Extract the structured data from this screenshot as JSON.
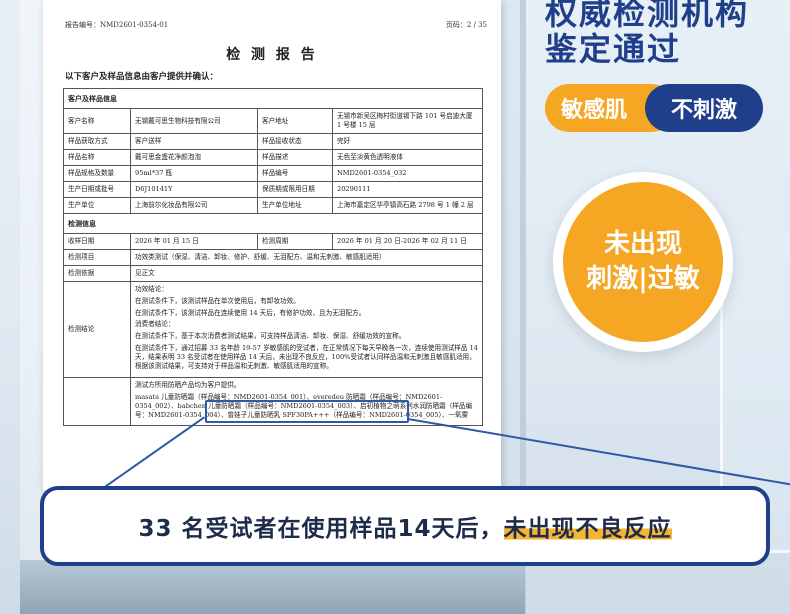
{
  "doc": {
    "report_no": "报告编号：NMD2601-0354-01",
    "page": "页码：2 / 35",
    "title": "检 测 报 告",
    "subtitle": "以下客户及样品信息由客户提供并确认：",
    "sec_customer": "客户及样品信息",
    "customer_name_label": "客户名称",
    "customer_name": "无锡戴可思生物科技有限公司",
    "customer_addr_label": "客户地址",
    "customer_addr": "无锡市新吴区梅村街道锡下路 101 号启迪大厦 1 号楼 15 层",
    "sample_way_label": "样品获取方式",
    "sample_way": "客户送样",
    "sample_state_label": "样品接收状态",
    "sample_state": "完好",
    "sample_name_label": "样品名称",
    "sample_name": "戴可思金盏花净颜泡泡",
    "sample_desc_label": "样品描述",
    "sample_desc": "无色至淡黄色透明液体",
    "spec_label": "样品规格及数量",
    "spec": "95ml*37 瓶",
    "sample_no_label": "样品编号",
    "sample_no": "NMD2601-0354_032",
    "batch_label": "生产日期或批号",
    "batch": "D6J10141Y",
    "expiry_label": "保质期或限用日期",
    "expiry": "20290111",
    "maker_label": "生产单位",
    "maker": "上海前尔化妆品有限公司",
    "maker_addr_label": "生产单位地址",
    "maker_addr": "上海市嘉定区华亭镇高石路 2798 号 1 幢 2 层",
    "sec_test": "检测信息",
    "recv_date_label": "收样日期",
    "recv_date": "2026 年 01 月 15 日",
    "test_period_label": "检测周期",
    "test_period": "2026 年 01 月 20 日-2026 年 02 月 11 日",
    "items_label": "检测项目",
    "items": "功效类测试（保湿、清洁、卸妆、修护、舒缓、无泪配方、温和无刺激、敏感肌适用）",
    "basis_label": "检测依据",
    "basis": "见正文",
    "conclusion_label": "检测结论",
    "c1": "功效结论：",
    "c2": "在测试条件下，该测试样品在单次使用后，有卸妆功效。",
    "c3": "在测试条件下，该测试样品在连续使用 14 天后，有修护功效，且为无泪配方。",
    "c4": "消费者结论：",
    "c5": "在测试条件下，基于本次消费者测试结果，可支持样品清洁、卸妆、保湿、舒缓功效的宣称。",
    "c6": "在测试条件下，通过招募 33 名年龄 19-57 岁敏感肌的受试者，在正常情况下每天早晚各一次，连续使用测试样品 14 天，结果表明 33 名受试者在使用样品 14 天后，未出现不良反应，100%受试者认同样品温和无刺激且敏感肌适用，根据该测试结果，可支持对于样品温和无刺激、敏感肌适用的宣称。",
    "c7": "测试方所用防晒产品均为客户提供。",
    "c8": "masata 儿童防晒霜（样品编号：NMD2601-0354_001）、everedeu 防晒霜（样品编号：NMD2601-0354_002）、babchen 儿童防晒霜（样品编号：NMD2601-0354_003）、启初植物之萌系列水润防晒霜（样品编号：NMD2601-0354_004）、曾娃子儿童防晒乳 SPF30PA+++（样品编号：NMD2601-0354_005）、一氧雾"
  },
  "headline": {
    "line1": "权威检测机构",
    "line2": "鉴定通过"
  },
  "pills": {
    "orange": "敏感肌",
    "blue": "不刺激"
  },
  "badge": {
    "line1": "未出现",
    "line2": "刺激|过敏"
  },
  "callout": {
    "prefix": "33 名受试者在使用样品14天后，",
    "emph": "未出现不良反应"
  },
  "colors": {
    "navy": "#1f3f8a",
    "orange": "#f5a623",
    "highlight": "#f5b532"
  }
}
